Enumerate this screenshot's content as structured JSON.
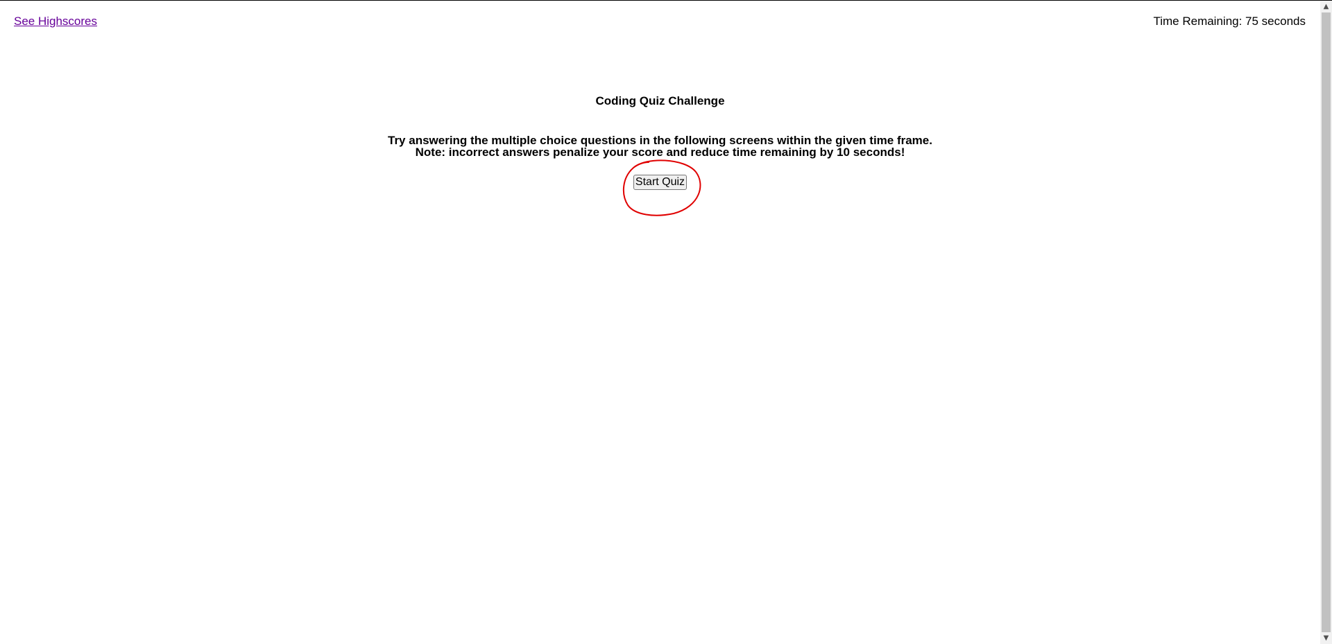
{
  "header": {
    "highscores_link": "See Highscores",
    "timer_text": "Time Remaining: 75 seconds"
  },
  "intro": {
    "title": "Coding Quiz Challenge",
    "description_line1": "Try answering the multiple choice questions in the following screens within the given time frame.",
    "description_line2": "Note: incorrect answers penalize your score and reduce time remaining by 10 seconds!",
    "start_button": "Start Quiz"
  },
  "colors": {
    "link": "#660099",
    "annotation": "#e00000",
    "text": "#000000"
  },
  "icons": {
    "scroll_up": "chevron-up-icon",
    "scroll_down": "chevron-down-icon"
  }
}
